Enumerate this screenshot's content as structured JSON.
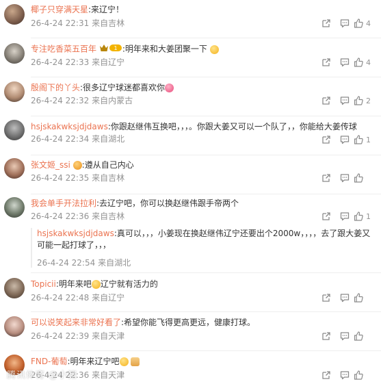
{
  "comments": [
    {
      "username": "椰子只穿满天星",
      "text": ":来辽宁！",
      "time": "26-4-24 22:31",
      "location": "来自吉林",
      "likes": "4"
    },
    {
      "username": "专注吃香菜五百年",
      "badge_text": "1",
      "text": ":明年来和大姜团聚一下",
      "time": "26-4-24 22:33",
      "location": "来自辽宁",
      "likes": "4"
    },
    {
      "username": "殷阁下的丫头",
      "text": ":很多辽宁球迷都喜欢你",
      "time": "26-4-24 22:32",
      "location": "来自内蒙古",
      "likes": "2"
    },
    {
      "username": "hsjskakwksjdjdaws",
      "text": ":你跟赵继伟互换吧，，，。你跟大姜又可以一个队了，，你能给大姜传球",
      "time": "26-4-24 22:34",
      "location": "来自湖北",
      "likes": "1"
    },
    {
      "username": "张文姬_ssi",
      "text": ":遵从自己内心",
      "time": "26-4-24 22:35",
      "location": "来自吉林",
      "likes": ""
    },
    {
      "username": "我会单手开法拉利",
      "text": ":去辽宁吧，你可以换赵继伟跟手帝两个",
      "time": "26-4-24 22:36",
      "location": "来自吉林",
      "likes": "1"
    },
    {
      "username": "Topicii",
      "text_a": ":明年来吧",
      "text_b": "辽宁就有活力的",
      "time": "26-4-24 22:48",
      "location": "来自辽宁",
      "likes": ""
    },
    {
      "username": "可以说笑起来非常好看了",
      "text": ":希望你能飞得更高更远，健康打球。",
      "time": "26-4-24 22:39",
      "location": "来自天津",
      "likes": ""
    },
    {
      "username": "FND-葡萄",
      "text": ":明年来辽宁吧",
      "time": "26-4-24 22:36",
      "location": "来自天津",
      "likes": ""
    }
  ],
  "reply": {
    "username": "hsjskakwksjdjdaws",
    "text": ":真可以，，，小姜现在换赵继伟辽宁还要出个2000w，，，，去了跟大姜又可能一起打球了，，，",
    "time": "26-4-24 22:54",
    "location": "来自湖北"
  },
  "watermark": "腾讯体育 @小猪"
}
